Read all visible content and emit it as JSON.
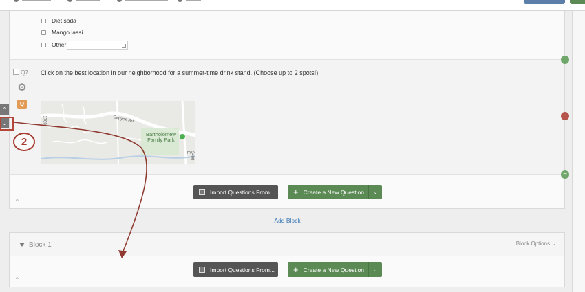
{
  "question_prev": {
    "choices": [
      {
        "label": "Diet soda"
      },
      {
        "label": "Mango lassi"
      },
      {
        "label": "Other"
      }
    ]
  },
  "q7": {
    "id": "Q7",
    "text": "Click on the best location in our neighborhood for a summer-time drink stand.  (Choose up to 2 spots!)",
    "map": {
      "road_label": "Canyon Rd",
      "park_line1": "Bartholomew",
      "park_line2": "Family Park",
      "side_label_left": "1700",
      "side_label_right": "3400 E"
    }
  },
  "actions": {
    "import_label": "Import Questions From...",
    "create_label": "Create a New Question",
    "add_block": "Add Block"
  },
  "block": {
    "title": "Block 1",
    "options": "Block Options"
  },
  "annotation": {
    "step_number": "2"
  },
  "colors": {
    "green_button": "#5b8a55",
    "dark_button": "#555555",
    "annotation_red": "#a43a2f",
    "link_blue": "#3a77b5"
  }
}
